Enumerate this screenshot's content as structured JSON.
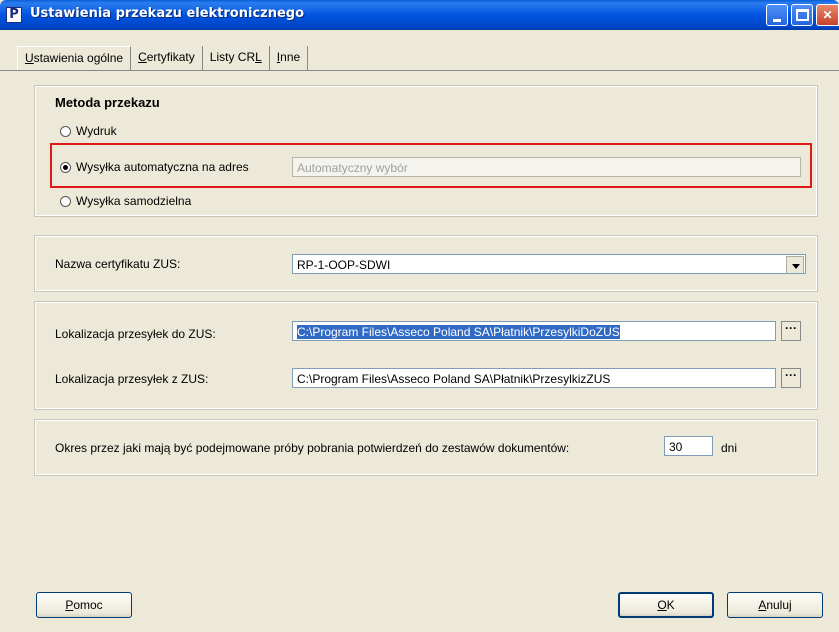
{
  "window": {
    "title": "Ustawienia przekazu elektronicznego",
    "app_icon_letter": "P"
  },
  "tabs": [
    {
      "label_underlined": "U",
      "label_rest": "stawienia ogólne",
      "active": true
    },
    {
      "label_underlined": "C",
      "label_rest": "ertyfikaty",
      "active": false
    },
    {
      "label_prefix": "Listy CR",
      "label_underlined": "L",
      "active": false
    },
    {
      "label_underlined": "I",
      "label_rest": "nne",
      "active": false
    }
  ],
  "method": {
    "heading": "Metoda przekazu",
    "options": [
      {
        "label": "Wydruk",
        "selected": false
      },
      {
        "label": "Wysyłka automatyczna na adres",
        "selected": true
      },
      {
        "label": "Wysyłka samodzielna",
        "selected": false
      }
    ],
    "address_placeholder": "Automatyczny wybór"
  },
  "certificate": {
    "label": "Nazwa certyfikatu ZUS:",
    "value": "RP-1-OOP-SDWI"
  },
  "locations": {
    "to_label": "Lokalizacja przesyłek do ZUS:",
    "to_value": "C:\\Program Files\\Asseco Poland SA\\Płatnik\\PrzesylkiDoZUS",
    "from_label": "Lokalizacja przesyłek z ZUS:",
    "from_value": "C:\\Program Files\\Asseco Poland SA\\Płatnik\\PrzesylkizZUS",
    "browse_label": "···"
  },
  "period": {
    "label": "Okres przez jaki mają być podejmowane próby pobrania potwierdzeń do zestawów dokumentów:",
    "value": "30",
    "unit": "dni"
  },
  "buttons": {
    "help_ul": "P",
    "help_rest": "omoc",
    "ok_ul": "O",
    "ok_rest": "K",
    "cancel_ul": "A",
    "cancel_rest": "nuluj"
  }
}
